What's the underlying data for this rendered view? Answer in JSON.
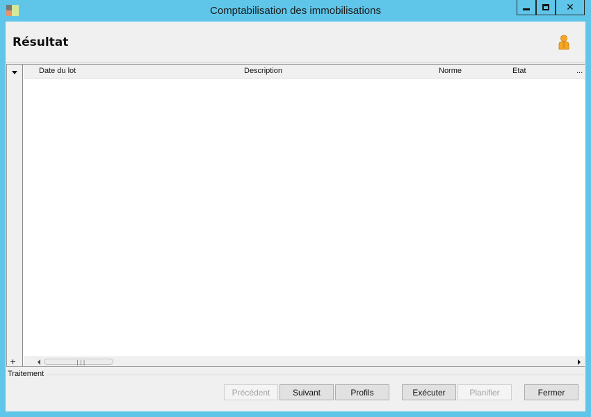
{
  "window": {
    "title": "Comptabilisation des immobilisations",
    "close_glyph": "✕"
  },
  "header": {
    "title": "Résultat",
    "icon": "user-icon"
  },
  "grid": {
    "columns": [
      "Date du lot",
      "Description",
      "Norme",
      "Etat",
      "..."
    ],
    "rows": [],
    "add_glyph": "+",
    "scroll_grip": "|||"
  },
  "section": {
    "label": "Traitement"
  },
  "buttons": {
    "previous": "Précédent",
    "next": "Suivant",
    "profiles": "Profils",
    "execute": "Exécuter",
    "schedule": "Planifier",
    "close": "Fermer"
  },
  "colors": {
    "title_bar": "#5fc6ea",
    "user_icon": "#f5a623"
  }
}
